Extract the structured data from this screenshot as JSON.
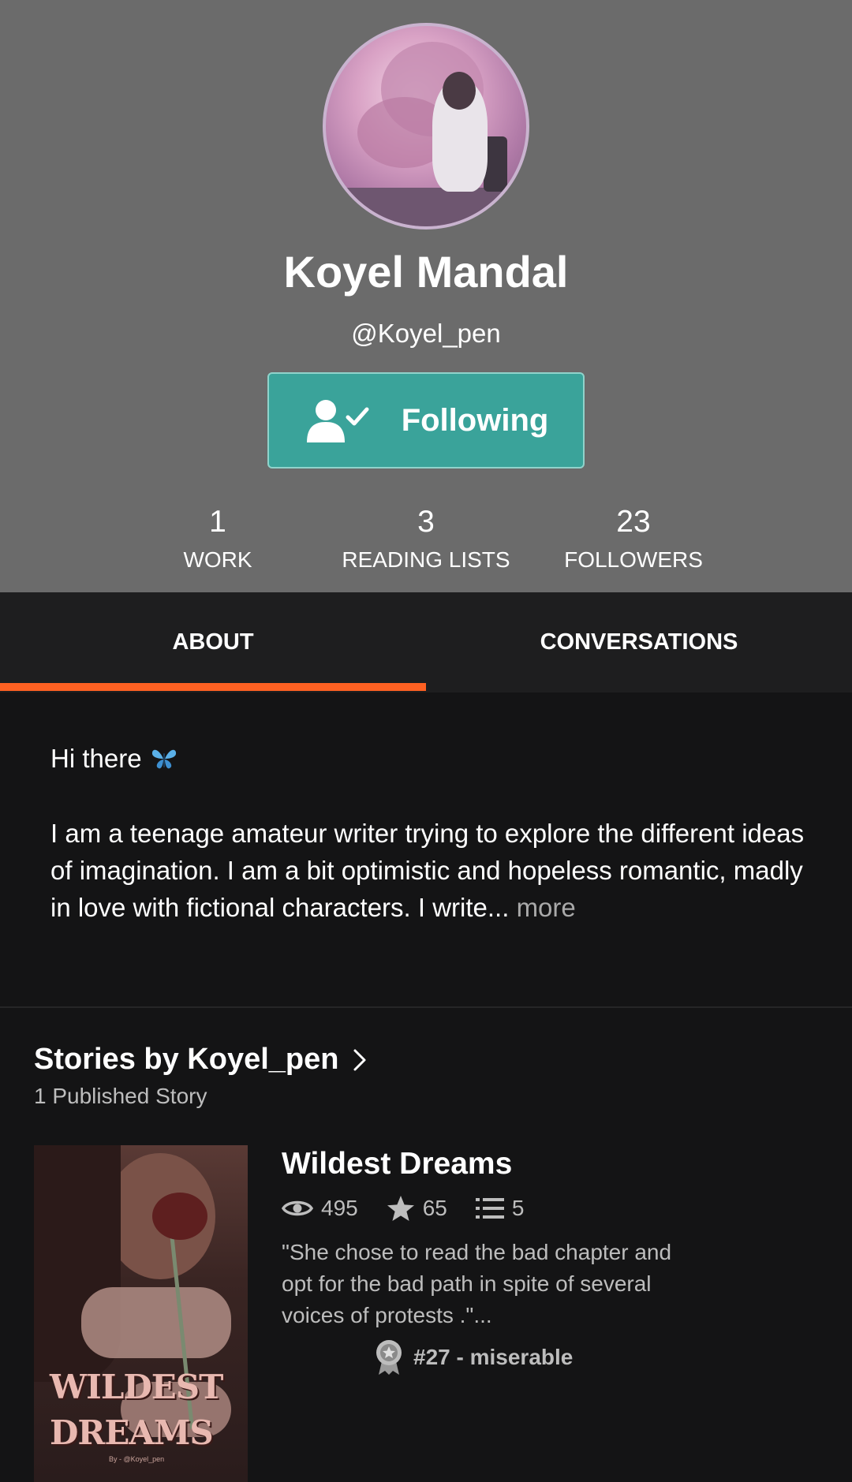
{
  "profile": {
    "name": "Koyel Mandal",
    "handle": "@Koyel_pen",
    "follow_label": "Following"
  },
  "stats": [
    {
      "value": "1",
      "label": "WORK"
    },
    {
      "value": "3",
      "label": "READING LISTS"
    },
    {
      "value": "23",
      "label": "FOLLOWERS"
    }
  ],
  "tabs": [
    {
      "label": "ABOUT",
      "active": true
    },
    {
      "label": "CONVERSATIONS",
      "active": false
    }
  ],
  "about": {
    "greeting": "Hi there",
    "greeting_emoji": "butterfly-emoji",
    "body": "I am a teenage amateur writer trying to explore the different ideas of imagination. I am a bit optimistic and hopeless romantic, madly in love with fictional characters. I write...",
    "more_label": "more"
  },
  "stories": {
    "heading": "Stories by Koyel_pen",
    "subheading": "1 Published Story",
    "items": [
      {
        "title": "Wildest Dreams",
        "cover_title_line1": "WILDEST",
        "cover_title_line2": "DREAMS",
        "cover_byline": "By - @Koyel_pen",
        "reads": "495",
        "votes": "65",
        "parts": "5",
        "description": "\"She chose to read the bad chapter and opt for the bad path in spite of several voices of protests .\"...",
        "rank": "#27 - miserable"
      }
    ]
  },
  "colors": {
    "header_bg": "#6b6b6b",
    "follow_button": "#3aa39a",
    "tab_indicator": "#ff6122",
    "page_bg": "#141415"
  }
}
